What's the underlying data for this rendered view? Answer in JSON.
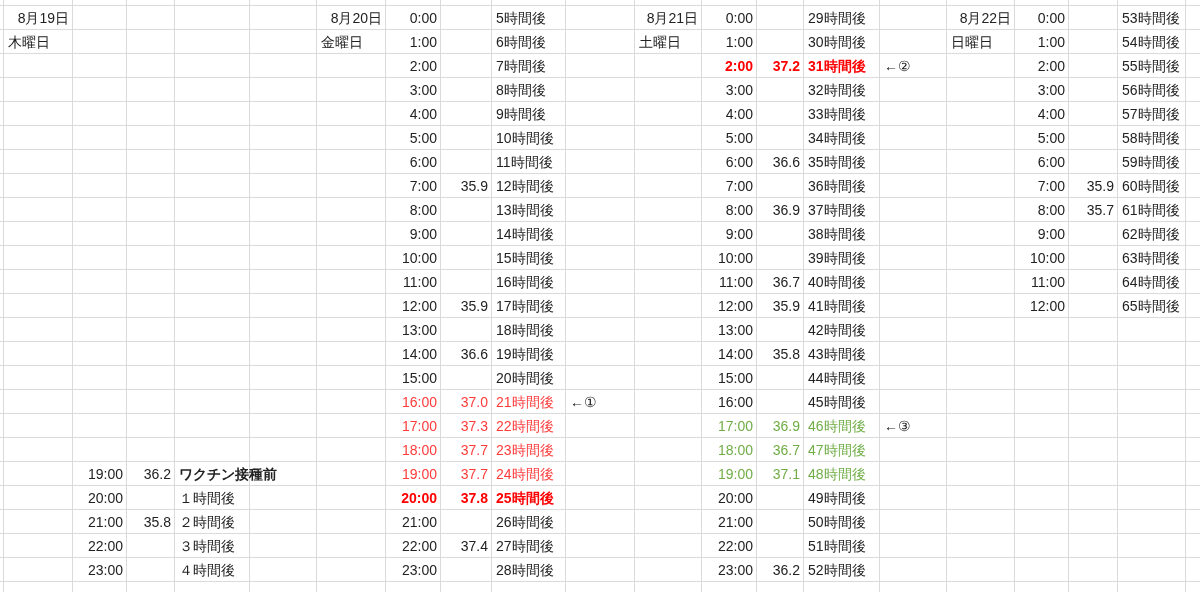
{
  "days": [
    {
      "date": "8月19日",
      "weekday": "木曜日",
      "entries": [
        {
          "time": "19:00",
          "temp": "36.2",
          "label": "ワクチン接種前",
          "kind": "milestone"
        },
        {
          "time": "20:00",
          "label": "１時間後",
          "kind": "normal"
        },
        {
          "time": "21:00",
          "temp": "35.8",
          "label": "２時間後",
          "kind": "normal"
        },
        {
          "time": "22:00",
          "label": "３時間後",
          "kind": "normal"
        },
        {
          "time": "23:00",
          "label": "４時間後",
          "kind": "normal"
        }
      ]
    },
    {
      "date": "8月20日",
      "weekday": "金曜日",
      "entries": [
        {
          "time": "0:00",
          "label": "5時間後",
          "kind": "normal"
        },
        {
          "time": "1:00",
          "label": "6時間後",
          "kind": "normal"
        },
        {
          "time": "2:00",
          "label": "7時間後",
          "kind": "normal"
        },
        {
          "time": "3:00",
          "label": "8時間後",
          "kind": "normal"
        },
        {
          "time": "4:00",
          "label": "9時間後",
          "kind": "normal"
        },
        {
          "time": "5:00",
          "label": "10時間後",
          "kind": "normal"
        },
        {
          "time": "6:00",
          "label": "11時間後",
          "kind": "normal"
        },
        {
          "time": "7:00",
          "temp": "35.9",
          "label": "12時間後",
          "kind": "normal"
        },
        {
          "time": "8:00",
          "label": "13時間後",
          "kind": "normal"
        },
        {
          "time": "9:00",
          "label": "14時間後",
          "kind": "normal"
        },
        {
          "time": "10:00",
          "label": "15時間後",
          "kind": "normal"
        },
        {
          "time": "11:00",
          "label": "16時間後",
          "kind": "normal"
        },
        {
          "time": "12:00",
          "temp": "35.9",
          "label": "17時間後",
          "kind": "normal"
        },
        {
          "time": "13:00",
          "label": "18時間後",
          "kind": "normal"
        },
        {
          "time": "14:00",
          "temp": "36.6",
          "label": "19時間後",
          "kind": "normal"
        },
        {
          "time": "15:00",
          "label": "20時間後",
          "kind": "normal"
        },
        {
          "time": "16:00",
          "temp": "37.0",
          "label": "21時間後",
          "note": "←①",
          "kind": "fever"
        },
        {
          "time": "17:00",
          "temp": "37.3",
          "label": "22時間後",
          "kind": "fever"
        },
        {
          "time": "18:00",
          "temp": "37.7",
          "label": "23時間後",
          "kind": "fever"
        },
        {
          "time": "19:00",
          "temp": "37.7",
          "label": "24時間後",
          "kind": "fever"
        },
        {
          "time": "20:00",
          "temp": "37.8",
          "label": "25時間後",
          "kind": "peak"
        },
        {
          "time": "21:00",
          "label": "26時間後",
          "kind": "normal"
        },
        {
          "time": "22:00",
          "temp": "37.4",
          "label": "27時間後",
          "kind": "normal"
        },
        {
          "time": "23:00",
          "label": "28時間後",
          "kind": "normal"
        }
      ]
    },
    {
      "date": "8月21日",
      "weekday": "土曜日",
      "entries": [
        {
          "time": "0:00",
          "label": "29時間後",
          "kind": "normal"
        },
        {
          "time": "1:00",
          "label": "30時間後",
          "kind": "normal"
        },
        {
          "time": "2:00",
          "temp": "37.2",
          "label": "31時間後",
          "note": "←②",
          "kind": "peak"
        },
        {
          "time": "3:00",
          "label": "32時間後",
          "kind": "normal"
        },
        {
          "time": "4:00",
          "label": "33時間後",
          "kind": "normal"
        },
        {
          "time": "5:00",
          "label": "34時間後",
          "kind": "normal"
        },
        {
          "time": "6:00",
          "temp": "36.6",
          "label": "35時間後",
          "kind": "normal"
        },
        {
          "time": "7:00",
          "label": "36時間後",
          "kind": "normal"
        },
        {
          "time": "8:00",
          "temp": "36.9",
          "label": "37時間後",
          "kind": "normal"
        },
        {
          "time": "9:00",
          "label": "38時間後",
          "kind": "normal"
        },
        {
          "time": "10:00",
          "label": "39時間後",
          "kind": "normal"
        },
        {
          "time": "11:00",
          "temp": "36.7",
          "label": "40時間後",
          "kind": "normal"
        },
        {
          "time": "12:00",
          "temp": "35.9",
          "label": "41時間後",
          "kind": "normal"
        },
        {
          "time": "13:00",
          "label": "42時間後",
          "kind": "normal"
        },
        {
          "time": "14:00",
          "temp": "35.8",
          "label": "43時間後",
          "kind": "normal"
        },
        {
          "time": "15:00",
          "label": "44時間後",
          "kind": "normal"
        },
        {
          "time": "16:00",
          "label": "45時間後",
          "kind": "normal"
        },
        {
          "time": "17:00",
          "temp": "36.9",
          "label": "46時間後",
          "note": "←③",
          "kind": "recovery"
        },
        {
          "time": "18:00",
          "temp": "36.7",
          "label": "47時間後",
          "kind": "recovery"
        },
        {
          "time": "19:00",
          "temp": "37.1",
          "label": "48時間後",
          "kind": "recovery"
        },
        {
          "time": "20:00",
          "label": "49時間後",
          "kind": "normal"
        },
        {
          "time": "21:00",
          "label": "50時間後",
          "kind": "normal"
        },
        {
          "time": "22:00",
          "label": "51時間後",
          "kind": "normal"
        },
        {
          "time": "23:00",
          "temp": "36.2",
          "label": "52時間後",
          "kind": "normal"
        }
      ]
    },
    {
      "date": "8月22日",
      "weekday": "日曜日",
      "entries": [
        {
          "time": "0:00",
          "label": "53時間後",
          "kind": "normal"
        },
        {
          "time": "1:00",
          "label": "54時間後",
          "kind": "normal"
        },
        {
          "time": "2:00",
          "label": "55時間後",
          "kind": "normal"
        },
        {
          "time": "3:00",
          "label": "56時間後",
          "kind": "normal"
        },
        {
          "time": "4:00",
          "label": "57時間後",
          "kind": "normal"
        },
        {
          "time": "5:00",
          "label": "58時間後",
          "kind": "normal"
        },
        {
          "time": "6:00",
          "label": "59時間後",
          "kind": "normal"
        },
        {
          "time": "7:00",
          "temp": "35.9",
          "label": "60時間後",
          "kind": "normal"
        },
        {
          "time": "8:00",
          "temp": "35.7",
          "label": "61時間後",
          "kind": "normal"
        },
        {
          "time": "9:00",
          "label": "62時間後",
          "kind": "normal"
        },
        {
          "time": "10:00",
          "label": "63時間後",
          "kind": "normal"
        },
        {
          "time": "11:00",
          "label": "64時間後",
          "kind": "normal"
        },
        {
          "time": "12:00",
          "label": "65時間後",
          "kind": "normal"
        }
      ]
    }
  ]
}
